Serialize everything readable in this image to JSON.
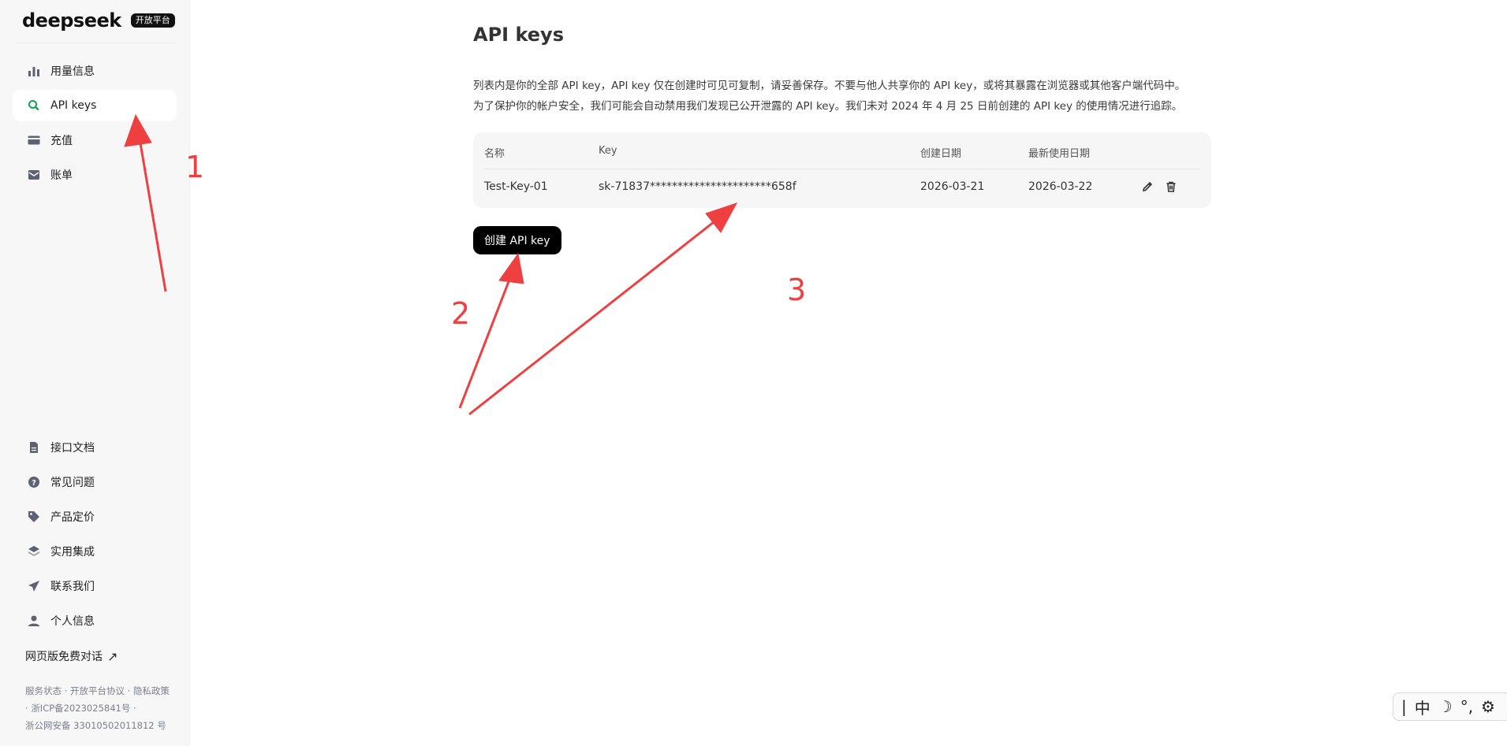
{
  "logo": {
    "word": "deepseek",
    "badge": "开放平台"
  },
  "nav_top": [
    {
      "label": "用量信息",
      "icon": "bar-chart-icon"
    },
    {
      "label": "API keys",
      "icon": "search-key-icon",
      "active": true
    },
    {
      "label": "充值",
      "icon": "credit-card-icon"
    },
    {
      "label": "账单",
      "icon": "envelope-icon"
    }
  ],
  "nav_bottom": [
    {
      "label": "接口文档",
      "icon": "document-icon"
    },
    {
      "label": "常见问题",
      "icon": "question-icon"
    },
    {
      "label": "产品定价",
      "icon": "price-tag-icon"
    },
    {
      "label": "实用集成",
      "icon": "layers-icon"
    },
    {
      "label": "联系我们",
      "icon": "send-icon"
    },
    {
      "label": "个人信息",
      "icon": "user-icon"
    }
  ],
  "web_chat": {
    "label": "网页版免费对话",
    "icon": "external-arrow-icon"
  },
  "footer": {
    "status": "服务状态",
    "agreement": "开放平台协议",
    "privacy": "隐私政策",
    "icp": "浙ICP备2023025841号",
    "police": "浙公网安备 33010502011812 号",
    "dot": "·"
  },
  "main": {
    "title": "API keys",
    "desc_line1": "列表内是你的全部 API key，API key 仅在创建时可见可复制，请妥善保存。不要与他人共享你的 API key，或将其暴露在浏览器或其他客户端代码中。",
    "desc_line2": "为了保护你的帐户安全，我们可能会自动禁用我们发现已公开泄露的 API key。我们未对 2024 年 4 月 25 日前创建的 API key 的使用情况进行追踪。"
  },
  "table": {
    "headers": [
      "名称",
      "Key",
      "创建日期",
      "最新使用日期"
    ],
    "rows": [
      {
        "name": "Test-Key-01",
        "key": "sk-71837**********************658f",
        "created": "2026-03-21",
        "last_used": "2026-03-22"
      }
    ]
  },
  "create_button": "创建 API key",
  "annotations": {
    "n1": "1",
    "n2": "2",
    "n3": "3",
    "color": "#ee4040"
  },
  "ime": {
    "cursor": "|",
    "mode": "中",
    "moon": "☽",
    "punct": "°,",
    "gear": "⚙"
  }
}
